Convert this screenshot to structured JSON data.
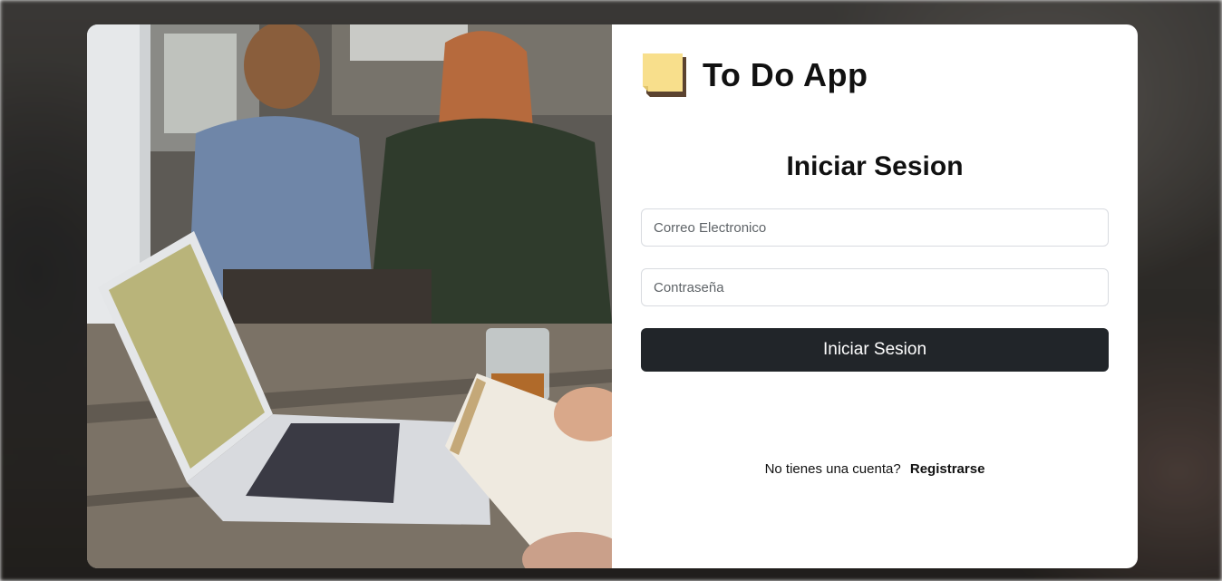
{
  "app": {
    "title": "To Do App",
    "logo_icon": "sticky-note-icon"
  },
  "login": {
    "heading": "Iniciar Sesion",
    "email_placeholder": "Correo Electronico",
    "email_value": "",
    "password_placeholder": "Contraseña",
    "password_value": "",
    "submit_label": "Iniciar Sesion"
  },
  "footer": {
    "prompt": "No tienes una cuenta?",
    "register_link": "Registrarse"
  },
  "colors": {
    "button_bg": "#212529",
    "note_yellow": "#f8df8c",
    "card_bg": "#ffffff"
  }
}
